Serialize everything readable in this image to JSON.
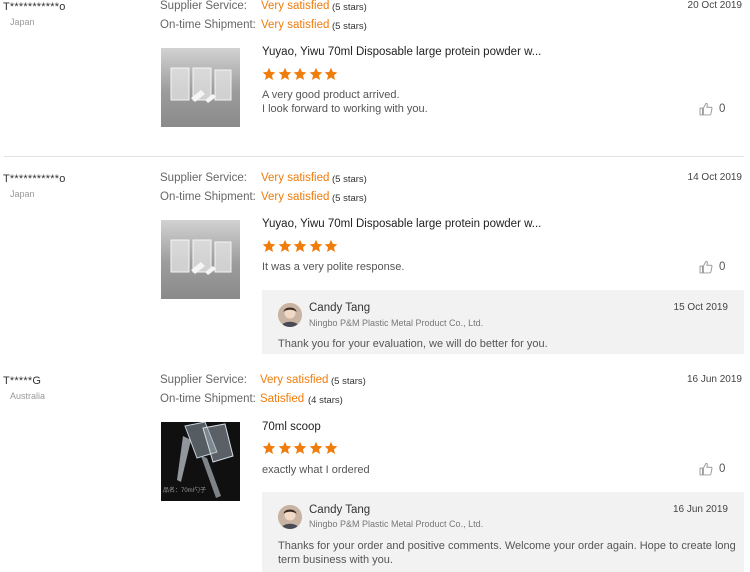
{
  "labels": {
    "supplier_service": "Supplier Service:",
    "ontime_shipment": "On-time Shipment:"
  },
  "colors": {
    "accent": "#f07c0c",
    "star": "#f07c0c",
    "reply_bg": "#f2f2f2"
  },
  "reviews": [
    {
      "buyer": "T***********o",
      "country": "Japan",
      "supplier_rating": "Very satisfied",
      "supplier_stars": "(5 stars)",
      "shipment_rating": "Very satisfied",
      "shipment_stars": "(5 stars)",
      "date": "20 Oct 2019",
      "product": "Yuyao, Yiwu 70ml Disposable large protein powder w...",
      "rating": 5,
      "comment_lines": [
        "A very good product arrived.",
        "I look forward to working with you."
      ],
      "likes": "0"
    },
    {
      "buyer": "T***********o",
      "country": "Japan",
      "supplier_rating": "Very satisfied",
      "supplier_stars": "(5 stars)",
      "shipment_rating": "Very satisfied",
      "shipment_stars": "(5 stars)",
      "date": "14 Oct 2019",
      "product": "Yuyao, Yiwu 70ml Disposable large protein powder w...",
      "rating": 5,
      "comment_lines": [
        "It was a very polite response."
      ],
      "likes": "0",
      "reply": {
        "name": "Candy Tang",
        "company": "Ningbo P&M Plastic Metal Product Co., Ltd.",
        "date": "15 Oct 2019",
        "text": "Thank you for your evaluation, we will do better for you."
      }
    },
    {
      "buyer": "T*****G",
      "country": "Australia",
      "supplier_rating": "Very satisfied",
      "supplier_stars": "(5 stars)",
      "shipment_rating": "Satisfied",
      "shipment_stars": "(4 stars)",
      "date": "16 Jun 2019",
      "product": "70ml scoop",
      "rating": 5,
      "comment_lines": [
        "exactly what I ordered"
      ],
      "likes": "0",
      "image_caption": "品名：70ml勺子",
      "reply": {
        "name": "Candy Tang",
        "company": "Ningbo P&M Plastic Metal Product Co., Ltd.",
        "date": "16 Jun 2019",
        "text": "Thanks for your order and positive comments. Welcome your order again. Hope to create long term business with you."
      }
    }
  ]
}
